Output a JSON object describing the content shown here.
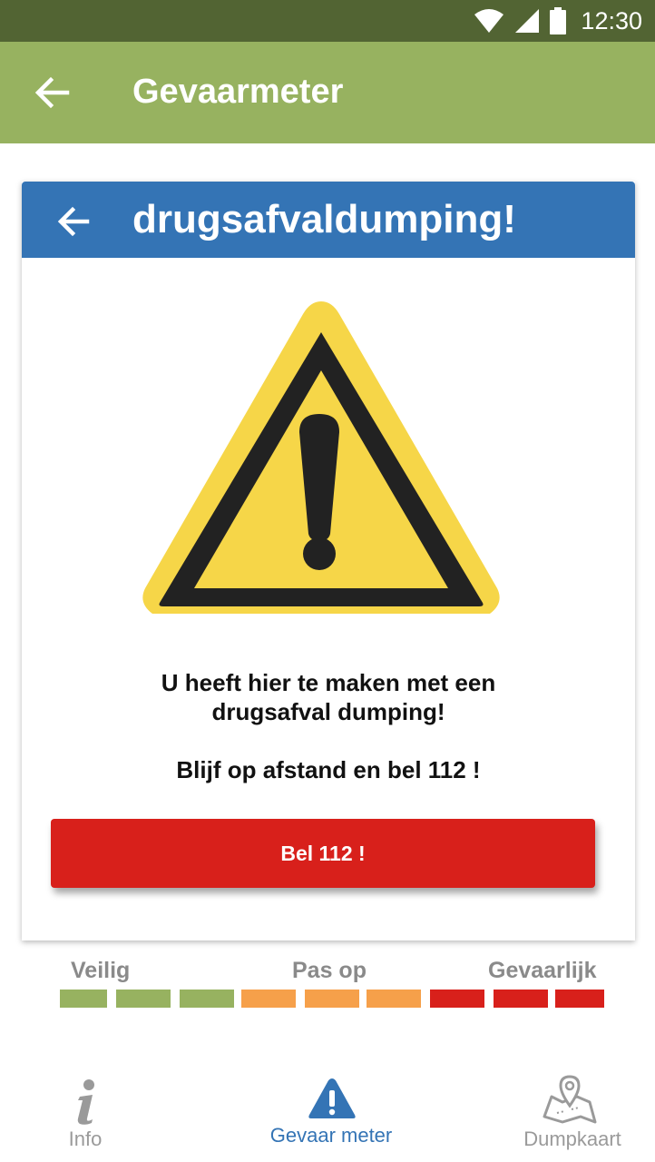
{
  "status_bar": {
    "time": "12:30",
    "icons": [
      "wifi-icon",
      "signal-icon",
      "battery-icon"
    ]
  },
  "app_bar": {
    "title": "Gevaarmeter",
    "back_icon": "arrow-left-icon"
  },
  "card": {
    "title": "drugsafvaldumping!",
    "back_icon": "arrow-left-icon",
    "warning_icon": "warning-triangle-icon",
    "message_line1": "U heeft hier te maken met een",
    "message_line2": "drugsafval dumping!",
    "message_line3": "Blijf op afstand en bel 112 !",
    "call_button_label": "Bel 112 !"
  },
  "meter": {
    "labels": {
      "safe": "Veilig",
      "caution": "Pas op",
      "danger": "Gevaarlijk"
    },
    "segments": [
      "green",
      "green",
      "green",
      "orange",
      "orange",
      "orange",
      "red",
      "red",
      "red"
    ]
  },
  "bottom_nav": {
    "items": [
      {
        "label": "Info",
        "icon": "info-icon",
        "active": false
      },
      {
        "label": "Gevaar meter",
        "icon": "warning-icon",
        "active": true
      },
      {
        "label": "Dumpkaart",
        "icon": "map-pin-icon",
        "active": false
      }
    ]
  },
  "colors": {
    "status_bar": "#526433",
    "app_bar": "#97b260",
    "card_header": "#3474b5",
    "call_button": "#d8201b",
    "meter_green": "#97b260",
    "meter_orange": "#f6a04a",
    "meter_red": "#d8201b",
    "warning_yellow": "#f6d648",
    "nav_active": "#3474b5",
    "nav_inactive": "#9a9a9a"
  }
}
